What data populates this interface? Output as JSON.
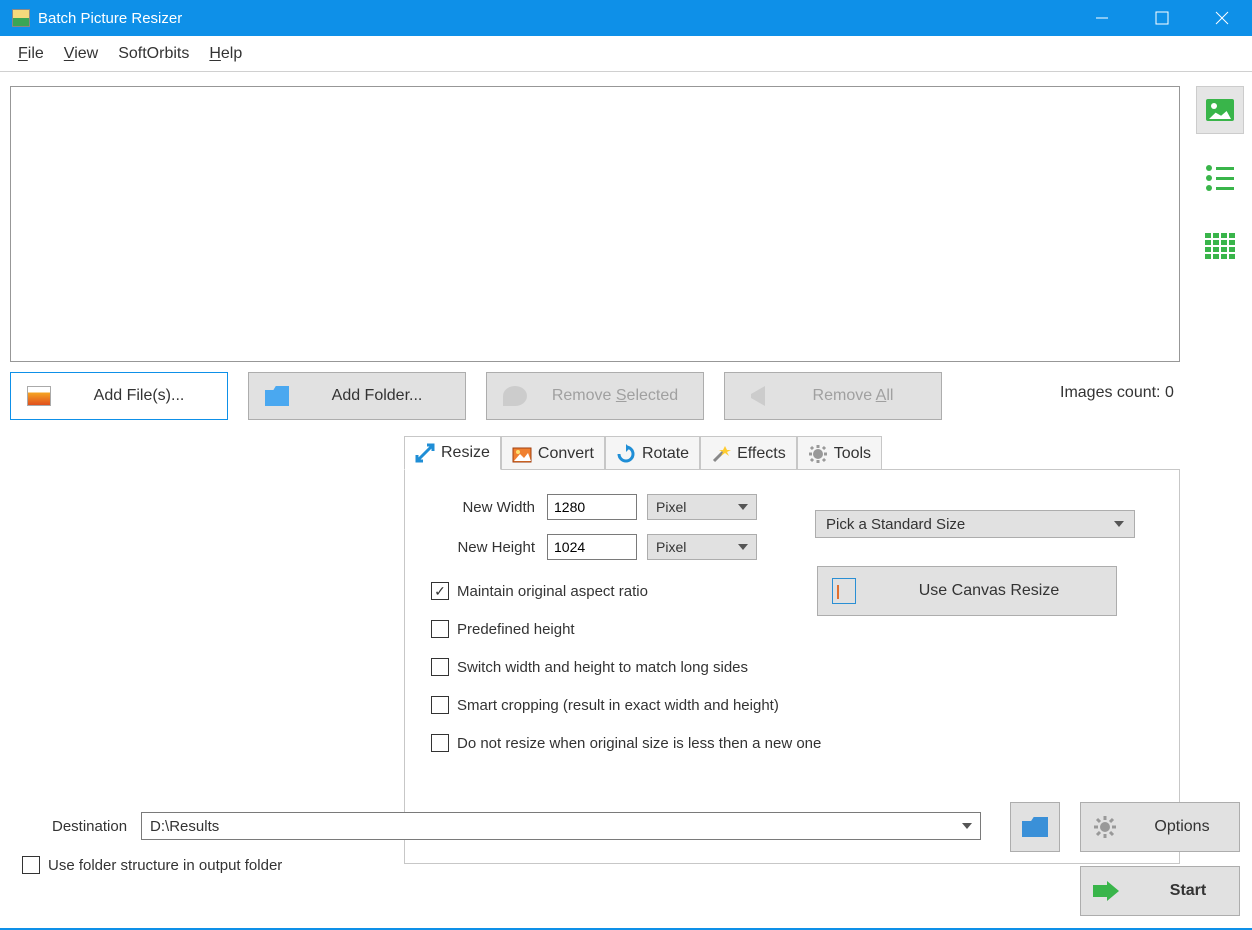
{
  "window": {
    "title": "Batch Picture Resizer"
  },
  "menu": {
    "file": "File",
    "view": "View",
    "softorbits": "SoftOrbits",
    "help": "Help"
  },
  "toolbar": {
    "add_files": "Add File(s)...",
    "add_folder": "Add Folder...",
    "remove_selected": "Remove Selected",
    "remove_all": "Remove All"
  },
  "images_count_label": "Images count: 0",
  "tabs": {
    "resize": "Resize",
    "convert": "Convert",
    "rotate": "Rotate",
    "effects": "Effects",
    "tools": "Tools"
  },
  "resize": {
    "new_width_label": "New Width",
    "new_width_value": "1280",
    "new_height_label": "New Height",
    "new_height_value": "1024",
    "unit_width": "Pixel",
    "unit_height": "Pixel",
    "pick_standard": "Pick a Standard Size",
    "canvas_btn": "Use Canvas Resize",
    "chk_aspect": "Maintain original aspect ratio",
    "chk_predef": "Predefined height",
    "chk_switch": "Switch width and height to match long sides",
    "chk_smart": "Smart cropping (result in exact width and height)",
    "chk_noupscale": "Do not resize when original size is less then a new one"
  },
  "destination": {
    "label": "Destination",
    "value": "D:\\Results",
    "folder_structure": "Use folder structure in output folder"
  },
  "buttons": {
    "options": "Options",
    "start": "Start"
  }
}
